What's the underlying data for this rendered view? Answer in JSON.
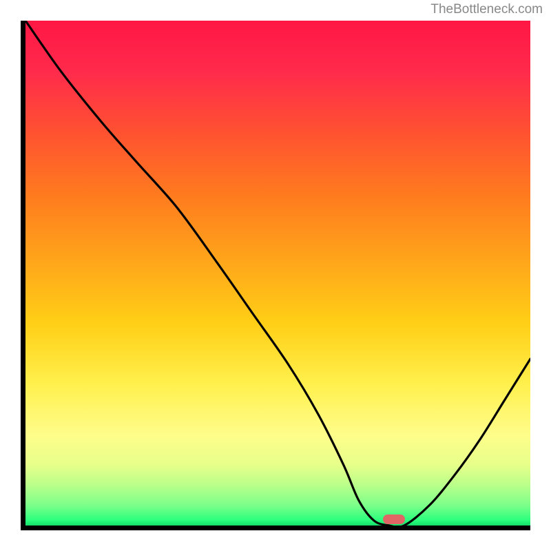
{
  "watermark": "TheBottleneck.com",
  "chart_data": {
    "type": "line",
    "title": "",
    "xlabel": "",
    "ylabel": "",
    "xlim": [
      0,
      100
    ],
    "ylim": [
      0,
      100
    ],
    "grid": false,
    "background": "bottleneck-gradient",
    "gradient_stops": [
      {
        "pos": 0,
        "color": "#ff1744"
      },
      {
        "pos": 35,
        "color": "#ff7c1e"
      },
      {
        "pos": 60,
        "color": "#ffcf16"
      },
      {
        "pos": 82,
        "color": "#fffd8a"
      },
      {
        "pos": 100,
        "color": "#15e06a"
      }
    ],
    "series": [
      {
        "name": "bottleneck-curve",
        "color": "#000000",
        "x": [
          0,
          7,
          15,
          22,
          30,
          38,
          45,
          52,
          58,
          63,
          66,
          69,
          72,
          75,
          80,
          85,
          90,
          95,
          100
        ],
        "y": [
          100,
          90,
          80,
          72,
          63,
          52,
          42,
          32,
          22,
          12,
          5,
          1,
          0,
          0,
          4,
          10,
          17,
          25,
          33
        ]
      }
    ],
    "marker": {
      "name": "optimal-point",
      "x": 73,
      "y": 1.2,
      "color": "#e06666"
    }
  }
}
